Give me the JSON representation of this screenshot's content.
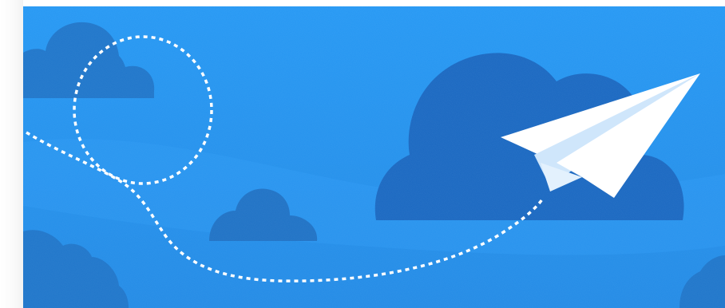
{
  "illustration": {
    "subject": "paper-plane",
    "colors": {
      "sky_top": "#2196f3",
      "sky_bottom": "#1e88e5",
      "cloud": "#1565c0",
      "cloud_light": "#1a73c9",
      "plane_white": "#ffffff",
      "plane_shade": "#cfe6fb",
      "trail": "#ffffff"
    }
  }
}
